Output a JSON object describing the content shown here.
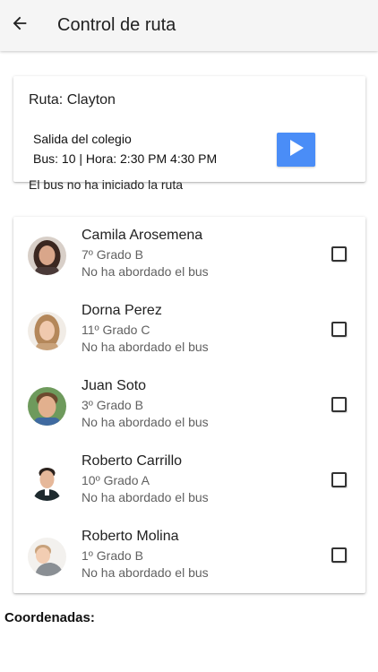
{
  "appbar": {
    "title": "Control de ruta",
    "back_icon": "arrow-left-icon"
  },
  "route": {
    "name": "Ruta: Clayton",
    "departure": "Salida del colegio",
    "bus_time": "Bus: 10 | Hora: 2:30 PM 4:30 PM",
    "status": "El bus no ha iniciado la ruta",
    "play_icon": "play-icon",
    "play_color": "#4a8df7"
  },
  "students": [
    {
      "name": "Camila Arosemena",
      "grade": "7º Grado B",
      "status": "No ha abordado el bus",
      "checked": false
    },
    {
      "name": "Dorna Perez",
      "grade": "11º Grado C",
      "status": "No ha abordado el bus",
      "checked": false
    },
    {
      "name": "Juan Soto",
      "grade": "3º Grado B",
      "status": "No ha abordado el bus",
      "checked": false
    },
    {
      "name": "Roberto Carrillo",
      "grade": "10º Grado A",
      "status": "No ha abordado el bus",
      "checked": false
    },
    {
      "name": "Roberto Molina",
      "grade": "1º Grado B",
      "status": "No ha abordado el bus",
      "checked": false
    }
  ],
  "coordinates": {
    "label": "Coordenadas:"
  }
}
